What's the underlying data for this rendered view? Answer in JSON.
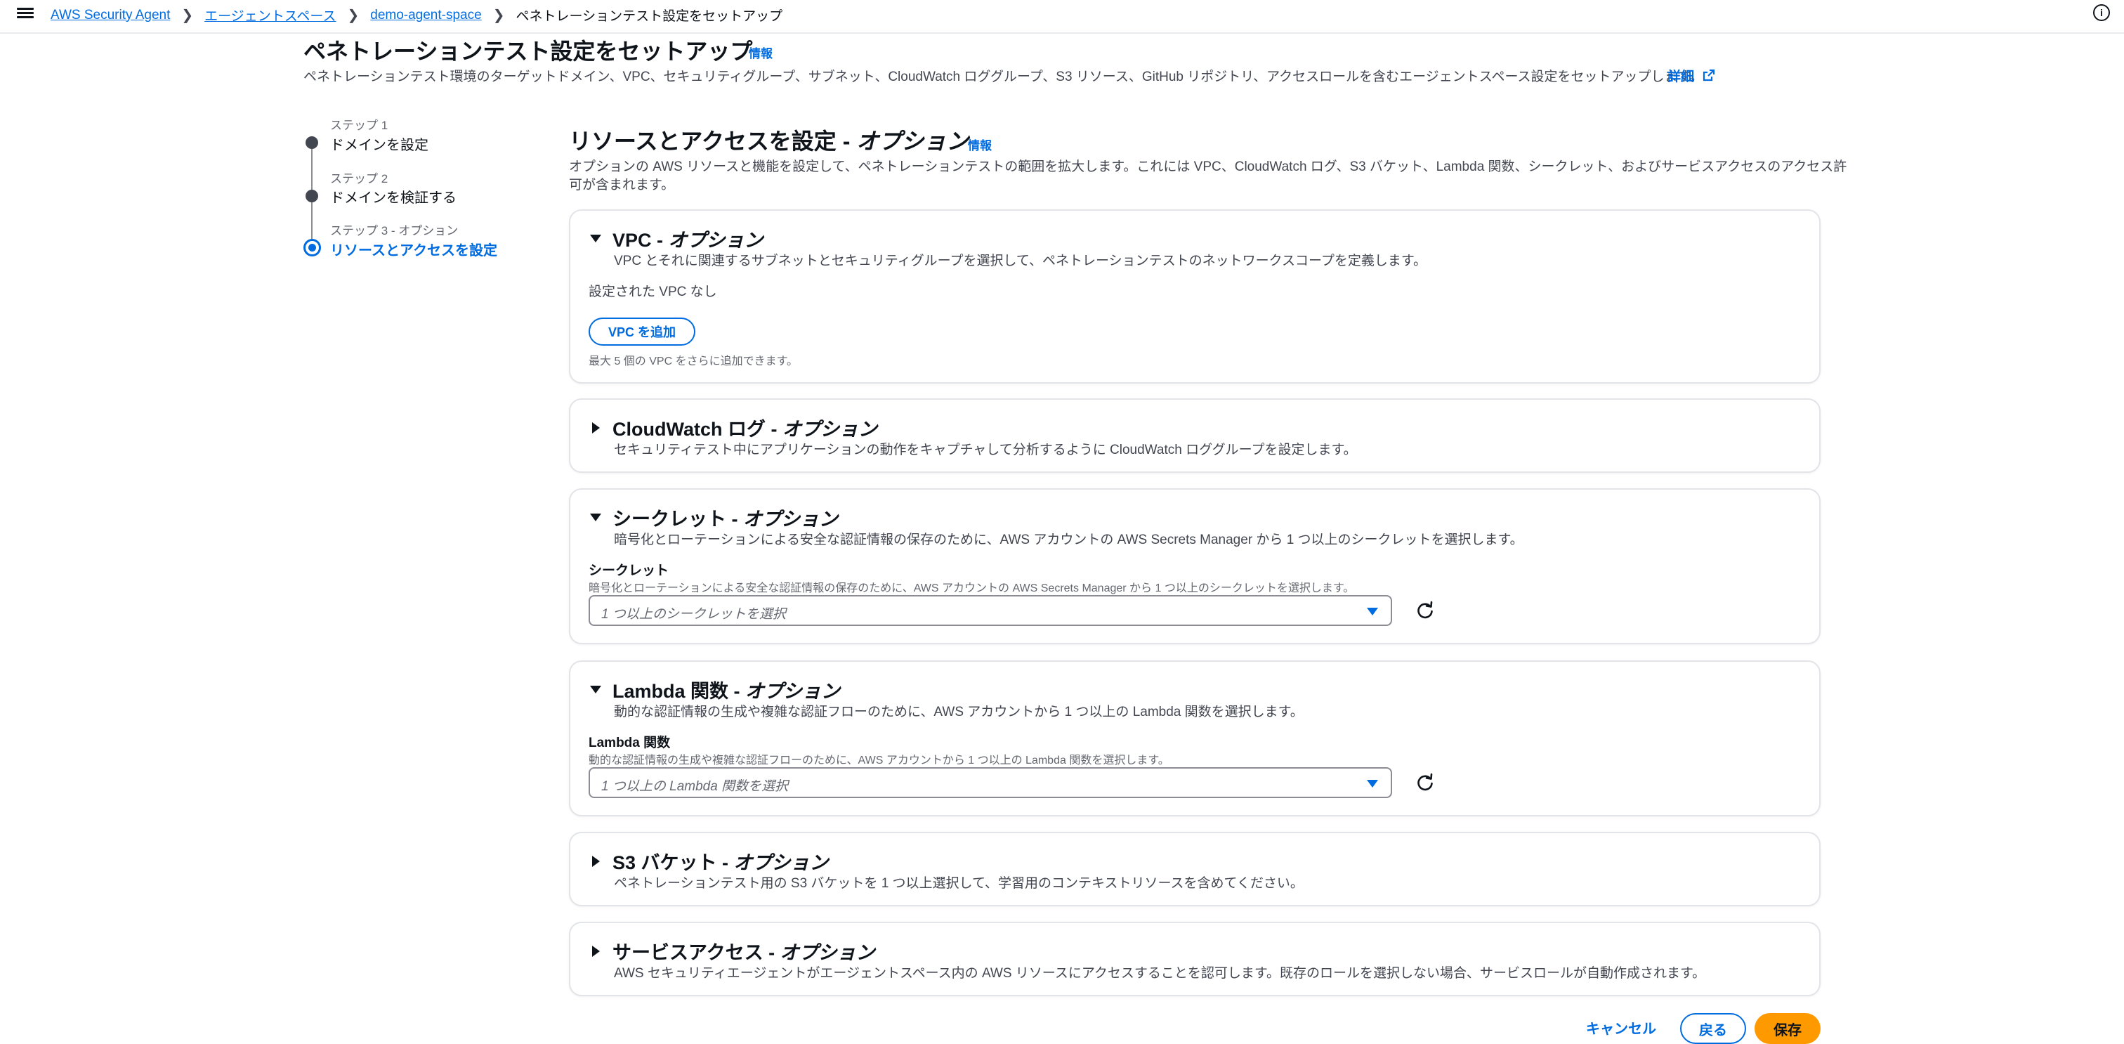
{
  "header": {
    "breadcrumbs": [
      {
        "label": "AWS Security Agent"
      },
      {
        "label": "エージェントスペース"
      },
      {
        "label": "demo-agent-space"
      },
      {
        "label": "ペネトレーションテスト設定をセットアップ"
      }
    ]
  },
  "page": {
    "title": "ペネトレーションテスト設定をセットアップ",
    "info": "情報",
    "description": "ペネトレーションテスト環境のターゲットドメイン、VPC、セキュリティグループ、サブネット、CloudWatch ロググループ、S3 リソース、GitHub リポジトリ、アクセスロールを含むエージェントスペース設定をセットアップします。",
    "details_link": "詳細"
  },
  "steps": [
    {
      "label": "ステップ 1",
      "name": "ドメインを設定"
    },
    {
      "label": "ステップ 2",
      "name": "ドメインを検証する"
    },
    {
      "label": "ステップ 3 - オプション",
      "name": "リソースとアクセスを設定"
    }
  ],
  "section": {
    "title_main": "リソースとアクセスを設定 - ",
    "title_opt": "オプション",
    "info": "情報",
    "description_line1": "オプションの AWS リソースと機能を設定して、ペネトレーションテストの範囲を拡大します。これには VPC、CloudWatch ログ、S3 バケット、Lambda 関数、シークレット、およびサービスアクセスのアクセス許",
    "description_line2": "可が含まれます。"
  },
  "vpc": {
    "title_main": "VPC - ",
    "title_opt": "オプション",
    "subtitle": "VPC とそれに関連するサブネットとセキュリティグループを選択して、ペネトレーションテストのネットワークスコープを定義します。",
    "empty_text": "設定された VPC なし",
    "add_button": "VPC を追加",
    "hint": "最大 5 個の VPC をさらに追加できます。"
  },
  "cloudwatch": {
    "title_main": "CloudWatch ログ - ",
    "title_opt": "オプション",
    "subtitle": "セキュリティテスト中にアプリケーションの動作をキャプチャして分析するように CloudWatch ロググループを設定します。"
  },
  "secrets": {
    "title_main": "シークレット - ",
    "title_opt": "オプション",
    "subtitle": "暗号化とローテーションによる安全な認証情報の保存のために、AWS アカウントの AWS Secrets Manager から 1 つ以上のシークレットを選択します。",
    "field_label": "シークレット",
    "field_desc": "暗号化とローテーションによる安全な認証情報の保存のために、AWS アカウントの AWS Secrets Manager から 1 つ以上のシークレットを選択します。",
    "placeholder": "1 つ以上のシークレットを選択"
  },
  "lambda": {
    "title_main": "Lambda 関数 - ",
    "title_opt": "オプション",
    "subtitle": "動的な認証情報の生成や複雑な認証フローのために、AWS アカウントから 1 つ以上の Lambda 関数を選択します。",
    "field_label": "Lambda 関数",
    "field_desc": "動的な認証情報の生成や複雑な認証フローのために、AWS アカウントから 1 つ以上の Lambda 関数を選択します。",
    "placeholder": "1 つ以上の Lambda 関数を選択"
  },
  "s3": {
    "title_main": "S3 バケット - ",
    "title_opt": "オプション",
    "subtitle": "ペネトレーションテスト用の S3 バケットを 1 つ以上選択して、学習用のコンテキストリソースを含めてください。"
  },
  "service_access": {
    "title_main": "サービスアクセス - ",
    "title_opt": "オプション",
    "subtitle": "AWS セキュリティエージェントがエージェントスペース内の AWS リソースにアクセスすることを認可します。既存のロールを選択しない場合、サービスロールが自動作成されます。"
  },
  "footer": {
    "cancel": "キャンセル",
    "back": "戻る",
    "save": "保存"
  },
  "colors": {
    "link": "#006ce0",
    "primary": "#ff9900",
    "text": "#0f141a",
    "muted": "#424650"
  }
}
